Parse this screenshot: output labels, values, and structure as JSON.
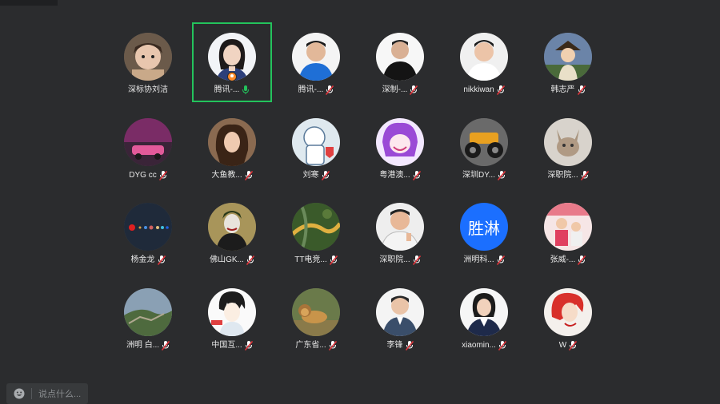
{
  "participants": [
    {
      "name": "深标协刘洁",
      "mic": "muted-none",
      "active": false,
      "avatar": "photo-child"
    },
    {
      "name": "腾讯-...",
      "mic": "speaking",
      "active": true,
      "avatar": "photo-woman",
      "badge": "host-badge"
    },
    {
      "name": "腾讯-...",
      "mic": "muted",
      "active": false,
      "avatar": "photo-man-blue"
    },
    {
      "name": "深制-...",
      "mic": "muted",
      "active": false,
      "avatar": "photo-man-black"
    },
    {
      "name": "nikkiwan",
      "mic": "muted",
      "active": false,
      "avatar": "photo-man-white"
    },
    {
      "name": "韩志严",
      "mic": "muted",
      "active": false,
      "avatar": "anime-boy"
    },
    {
      "name": "DYG cc",
      "mic": "muted",
      "active": false,
      "avatar": "pink-car"
    },
    {
      "name": "大鱼教...",
      "mic": "muted",
      "active": false,
      "avatar": "photo-woman-hair"
    },
    {
      "name": "刘寒",
      "mic": "muted",
      "active": false,
      "avatar": "cartoon-doctor"
    },
    {
      "name": "粤港澳...",
      "mic": "muted",
      "active": false,
      "avatar": "anime-purple"
    },
    {
      "name": "深圳DY...",
      "mic": "muted",
      "active": false,
      "avatar": "monster-truck"
    },
    {
      "name": "深职院...",
      "mic": "muted",
      "active": false,
      "avatar": "cat"
    },
    {
      "name": "杨金龙",
      "mic": "muted",
      "active": false,
      "avatar": "dots-dark"
    },
    {
      "name": "佛山GK...",
      "mic": "muted",
      "active": false,
      "avatar": "joker"
    },
    {
      "name": "TT电竞...",
      "mic": "muted",
      "active": false,
      "avatar": "aerial-road"
    },
    {
      "name": "深职院...",
      "mic": "muted",
      "active": false,
      "avatar": "photo-man-peace"
    },
    {
      "name": "洲明科...",
      "mic": "muted",
      "active": false,
      "avatar": "text",
      "avatar_text": "胜淋"
    },
    {
      "name": "张威-...",
      "mic": "muted",
      "active": false,
      "avatar": "photo-kids"
    },
    {
      "name": "洲明 白...",
      "mic": "muted",
      "active": false,
      "avatar": "great-wall"
    },
    {
      "name": "中国互...",
      "mic": "muted",
      "active": false,
      "avatar": "anime-l"
    },
    {
      "name": "广东省...",
      "mic": "muted",
      "active": false,
      "avatar": "lion"
    },
    {
      "name": "李锋",
      "mic": "muted",
      "active": false,
      "avatar": "photo-man-suit"
    },
    {
      "name": "xiaomin...",
      "mic": "muted",
      "active": false,
      "avatar": "photo-woman-suit"
    },
    {
      "name": "W",
      "mic": "muted",
      "active": false,
      "avatar": "ariel"
    }
  ],
  "chat": {
    "placeholder": "说点什么..."
  },
  "colors": {
    "background": "#2b2c2e",
    "active_border": "#23c35c",
    "mic_muted": "#e0333a",
    "mic_active": "#23c35c",
    "text_avatar": "#1b6fff"
  }
}
